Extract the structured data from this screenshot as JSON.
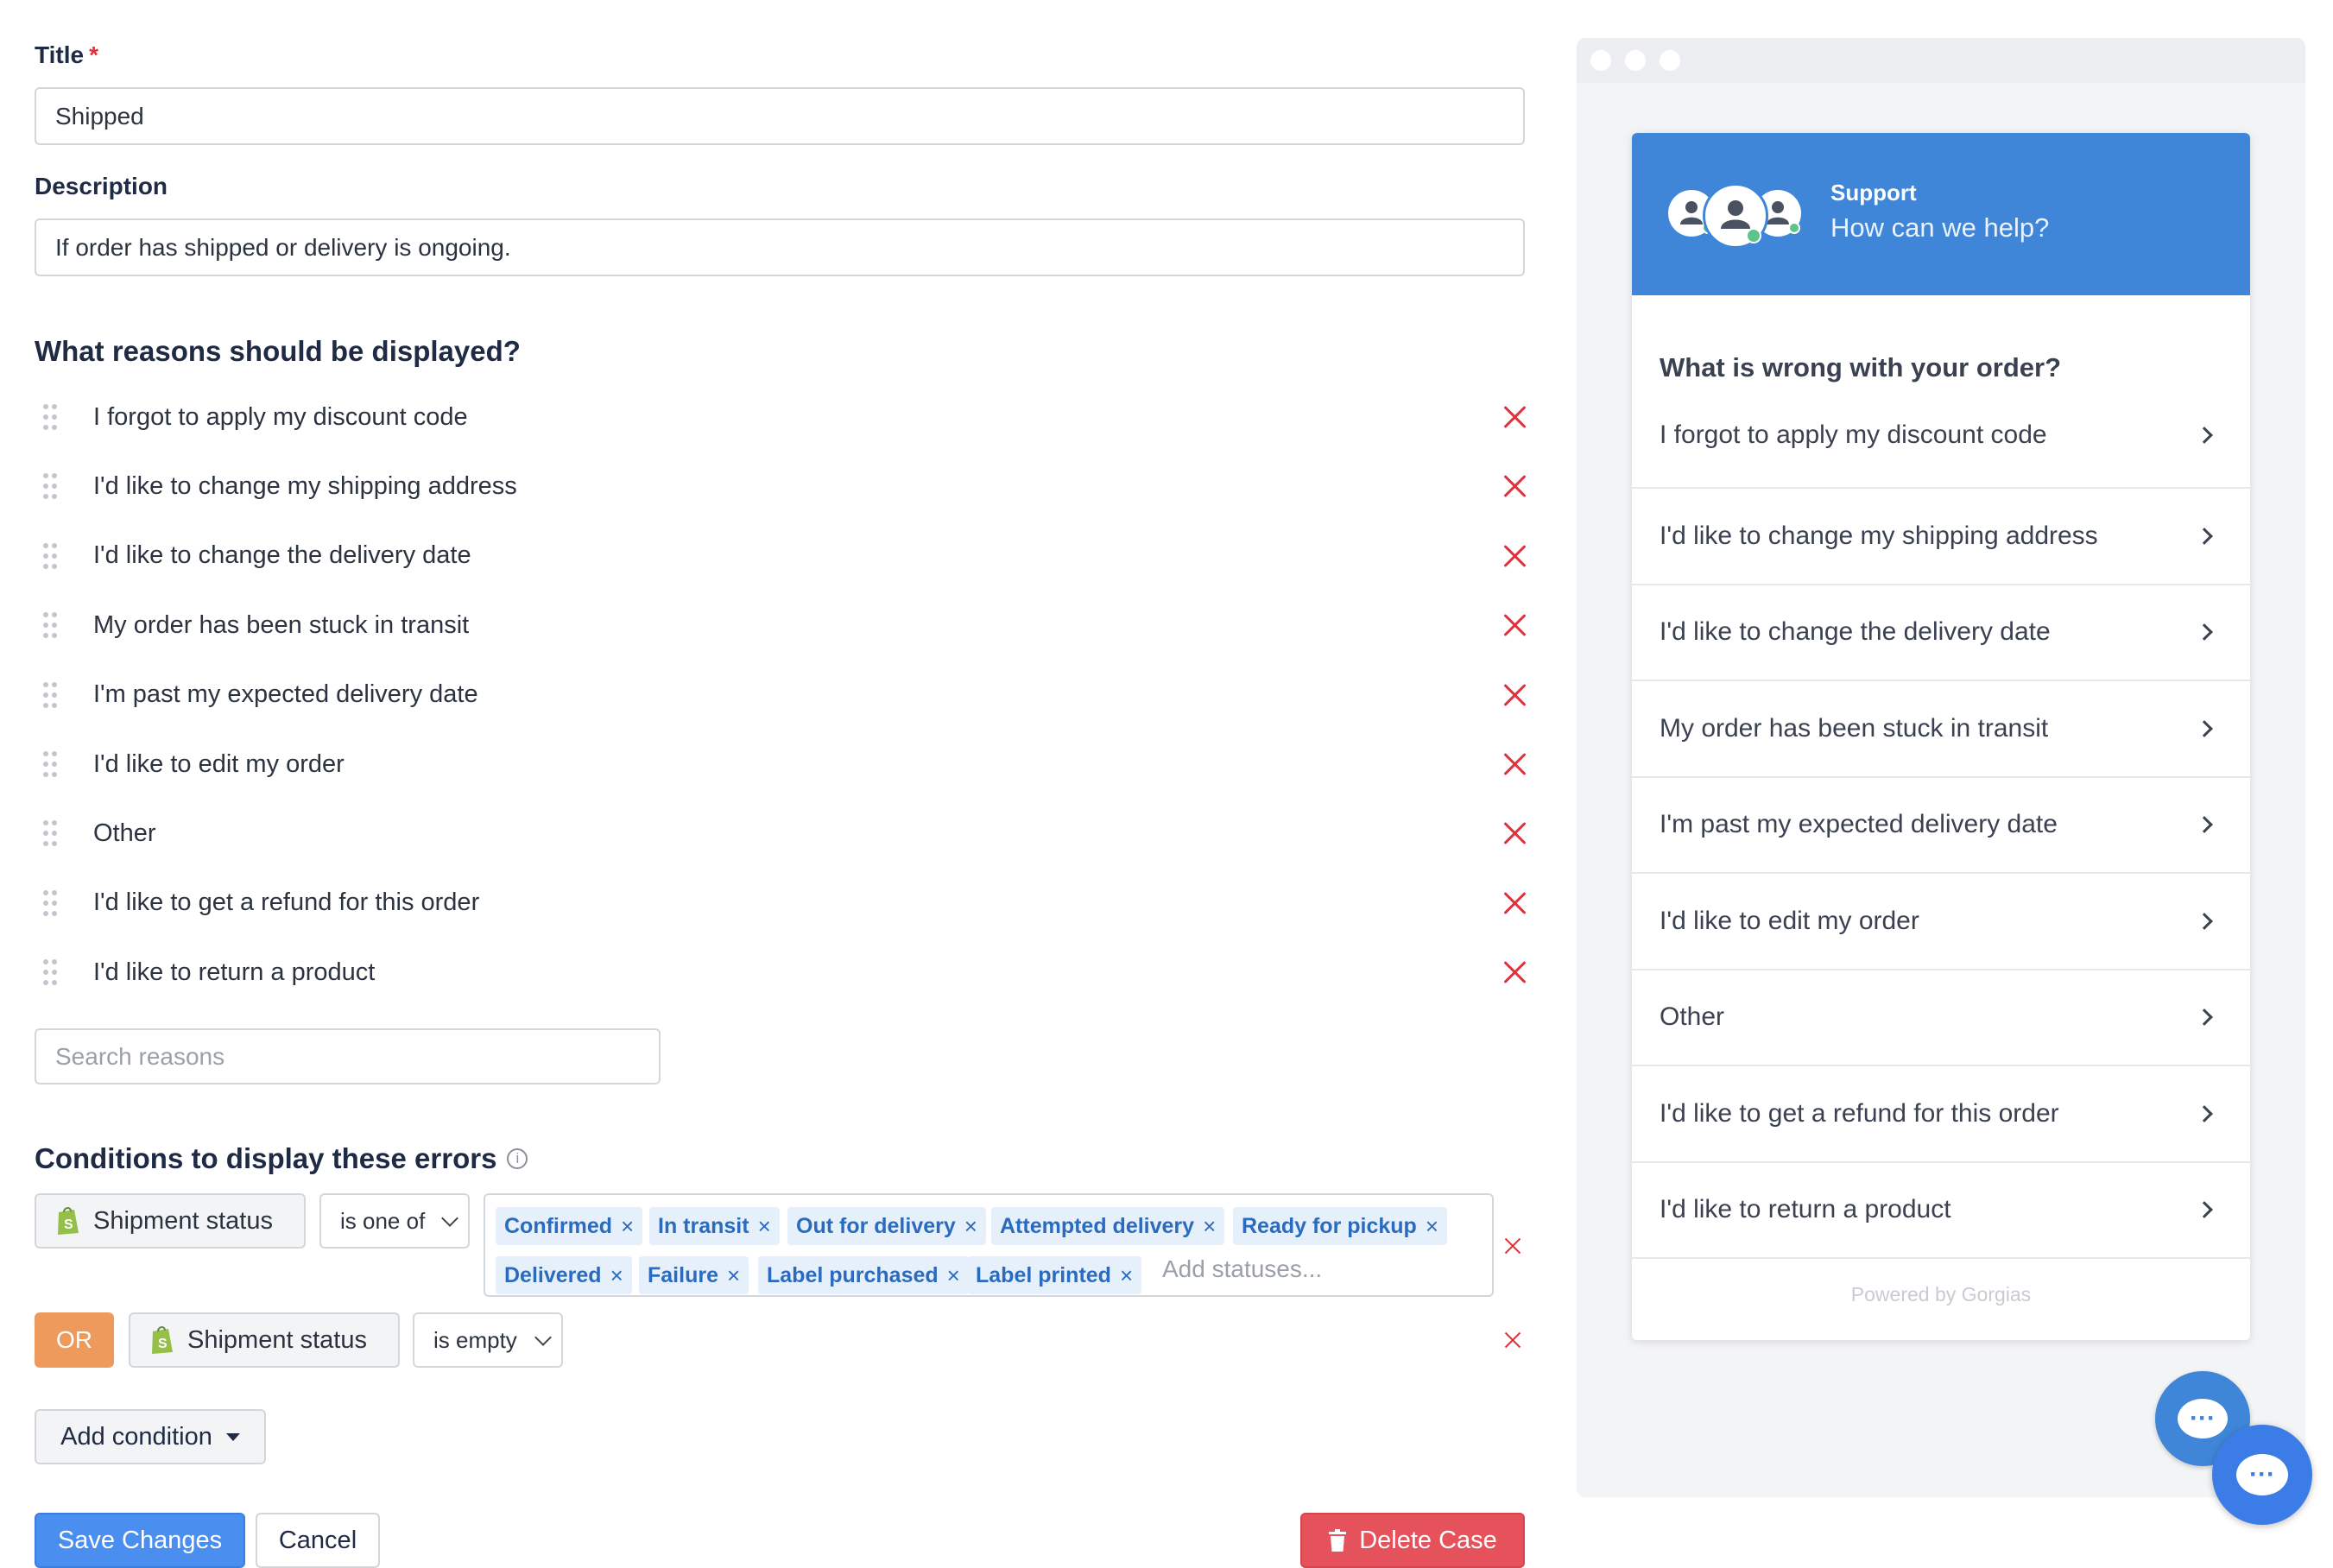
{
  "form": {
    "title_label": "Title",
    "required_mark": "*",
    "title_value": "Shipped",
    "description_label": "Description",
    "description_value": "If order has shipped or delivery is ongoing."
  },
  "reasons": {
    "heading": "What reasons should be displayed?",
    "items": [
      "I forgot to apply my discount code",
      "I'd like to change my shipping address",
      "I'd like to change the delivery date",
      "My order has been stuck in transit",
      "I'm past my expected delivery date",
      "I'd like to edit my order",
      "Other",
      "I'd like to get a refund for this order",
      "I'd like to return a product"
    ],
    "search_placeholder": "Search reasons"
  },
  "conditions": {
    "heading": "Conditions to display these errors",
    "info_icon": "info-icon",
    "rows": [
      {
        "field": "Shipment status",
        "operator": "is one of",
        "tags": [
          "Confirmed",
          "In transit",
          "Out for delivery",
          "Attempted delivery",
          "Ready for pickup",
          "Delivered",
          "Failure",
          "Label purchased",
          "Label printed"
        ],
        "add_placeholder": "Add statuses..."
      },
      {
        "connector": "OR",
        "field": "Shipment status",
        "operator": "is empty"
      }
    ],
    "add_condition": "Add condition"
  },
  "actions": {
    "save": "Save Changes",
    "cancel": "Cancel",
    "delete": "Delete Case"
  },
  "preview": {
    "header_title": "Support",
    "header_subtitle": "How can we help?",
    "question": "What is wrong with your order?",
    "items": [
      "I forgot to apply my discount code",
      "I'd like to change my shipping address",
      "I'd like to change the delivery date",
      "My order has been stuck in transit",
      "I'm past my expected delivery date",
      "I'd like to edit my order",
      "Other",
      "I'd like to get a refund for this order",
      "I'd like to return a product"
    ],
    "powered_by": "Powered by Gorgias"
  },
  "colors": {
    "accent": "#3f86d9",
    "danger": "#e0323c",
    "or_badge": "#ee9a5d",
    "tag_bg": "#e6f0fb",
    "tag_text": "#2a6bbf"
  }
}
